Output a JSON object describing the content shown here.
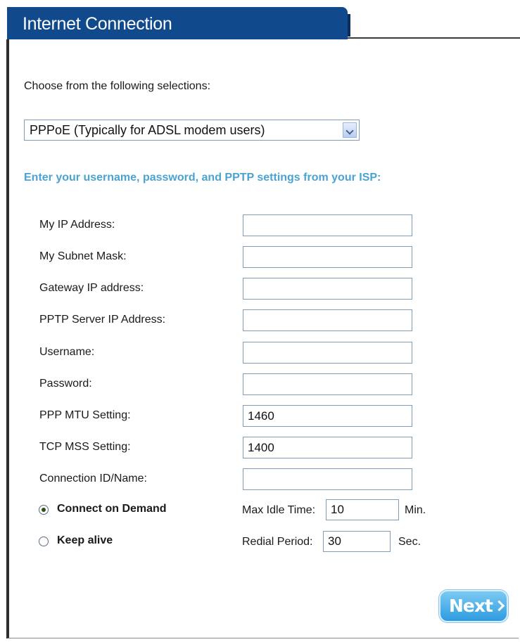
{
  "header": {
    "title": "Internet Connection"
  },
  "intro_text": "Choose from the following selections:",
  "connection_select": {
    "selected": "PPPoE (Typically for ADSL modem users)"
  },
  "section_heading": "Enter your username, password, and PPTP settings from your ISP:",
  "fields": [
    {
      "label": "My IP Address:",
      "value": ""
    },
    {
      "label": "My Subnet Mask:",
      "value": ""
    },
    {
      "label": "Gateway IP address:",
      "value": ""
    },
    {
      "label": "PPTP Server IP Address:",
      "value": ""
    },
    {
      "label": "Username:",
      "value": ""
    },
    {
      "label": "Password:",
      "value": ""
    },
    {
      "label": "PPP MTU Setting:",
      "value": "1460"
    },
    {
      "label": "TCP MSS Setting:",
      "value": "1400"
    },
    {
      "label": "Connection ID/Name:",
      "value": ""
    }
  ],
  "connect_on_demand": {
    "label": "Connect on Demand",
    "selected": true,
    "sub_label": "Max Idle Time:",
    "value": "10",
    "unit": "Min."
  },
  "keep_alive": {
    "label": "Keep alive",
    "selected": false,
    "sub_label": "Redial Period:",
    "value": "30",
    "unit": "Sec."
  },
  "next_button": {
    "label": "Next"
  }
}
